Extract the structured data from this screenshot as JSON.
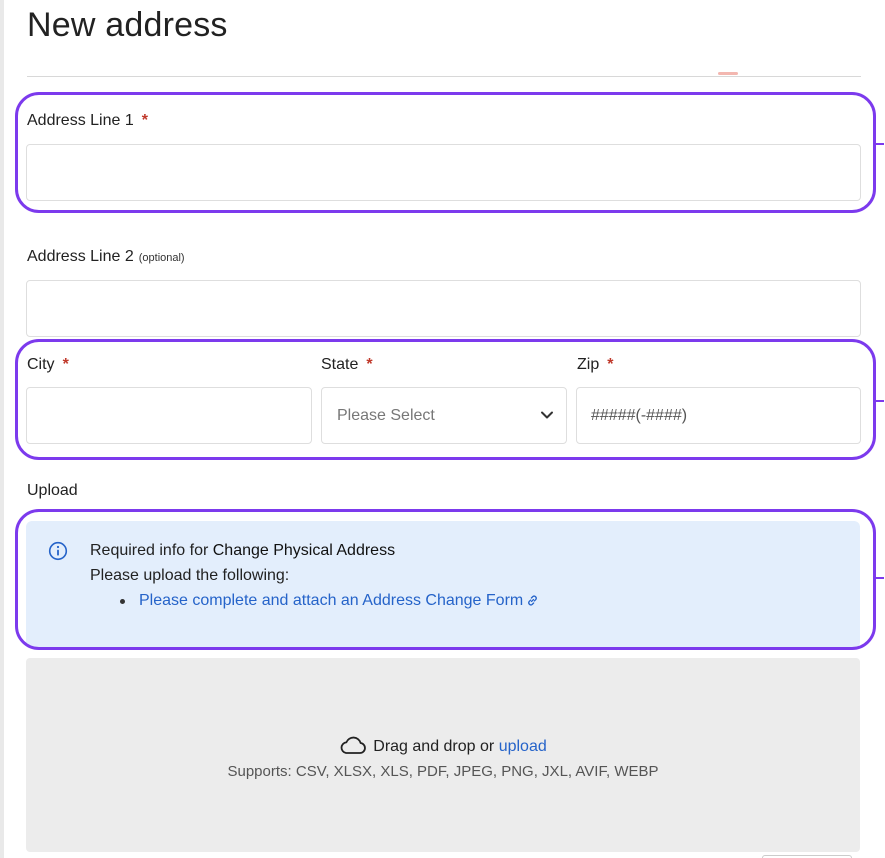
{
  "page": {
    "title": "New address"
  },
  "form": {
    "address_line1": {
      "label": "Address Line 1",
      "required_mark": "*",
      "value": "",
      "placeholder": ""
    },
    "address_line2": {
      "label": "Address Line 2",
      "optional_note": "(optional)",
      "value": "",
      "placeholder": ""
    },
    "city": {
      "label": "City",
      "required_mark": "*",
      "value": "",
      "placeholder": ""
    },
    "state": {
      "label": "State",
      "required_mark": "*",
      "selected": "Please Select"
    },
    "zip": {
      "label": "Zip",
      "required_mark": "*",
      "value": "",
      "placeholder": "#####(-####)"
    }
  },
  "upload": {
    "label": "Upload",
    "info": {
      "line1_prefix": "Required info for ",
      "line1_strong": "Change Physical Address",
      "line2": "Please upload the following:",
      "link_text": "Please complete and attach an Address Change Form",
      "icon": "info-circle-icon",
      "link_icon": "external-link-icon"
    },
    "dropzone": {
      "text": "Drag and drop or",
      "link_text": "upload",
      "supports": "Supports: CSV, XLSX, XLS, PDF, JPEG, PNG, JXL, AVIF, WEBP",
      "icon": "cloud-icon"
    }
  },
  "colors": {
    "highlight": "#7c3aed",
    "required": "#c0392b",
    "link": "#2563c9",
    "info_bg": "#e3eefc",
    "dropzone_bg": "#ececec"
  }
}
